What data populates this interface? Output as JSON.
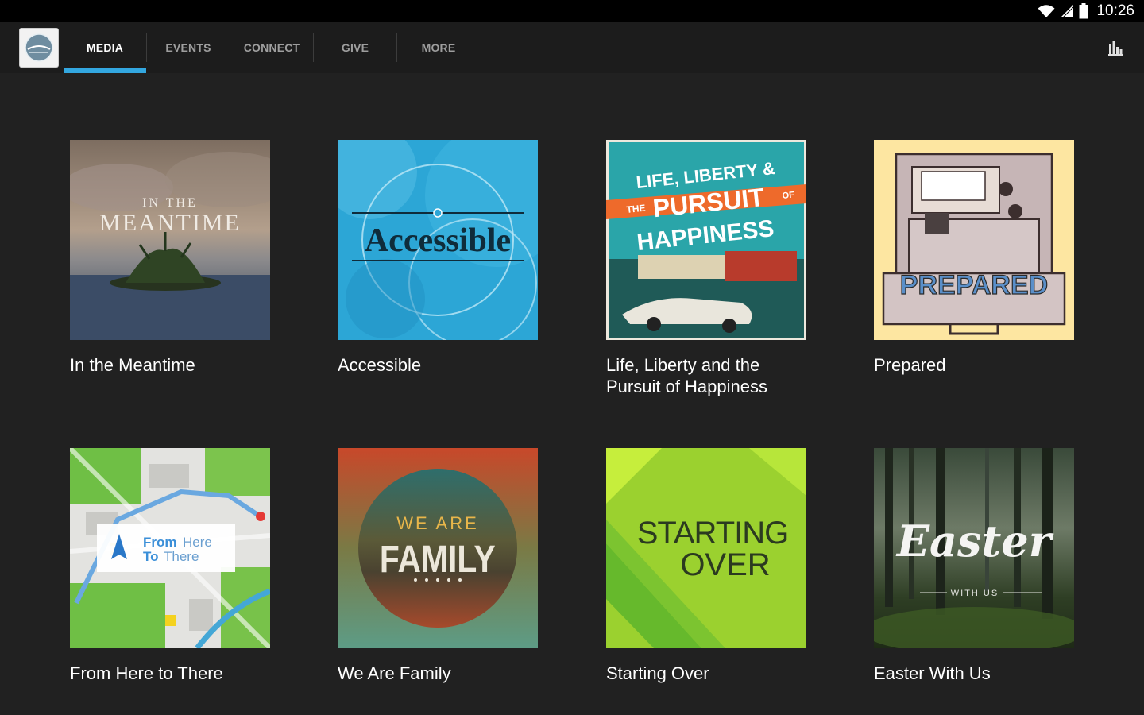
{
  "status_bar": {
    "time": "10:26",
    "icons": [
      "wifi-icon",
      "cell-signal-icon",
      "battery-icon"
    ]
  },
  "app": {
    "logo_icon": "church-logo-icon"
  },
  "tabs": [
    {
      "label": "MEDIA",
      "active": true
    },
    {
      "label": "EVENTS",
      "active": false
    },
    {
      "label": "CONNECT",
      "active": false
    },
    {
      "label": "GIVE",
      "active": false
    },
    {
      "label": "MORE",
      "active": false
    }
  ],
  "toolbar": {
    "stats_icon": "bar-chart-icon"
  },
  "colors": {
    "accent": "#33a7e0",
    "background": "#212121",
    "appbar": "#1c1c1c"
  },
  "series": [
    {
      "title": "In the Meantime",
      "art": {
        "line1": "IN THE",
        "line2": "MEANTIME"
      }
    },
    {
      "title": "Accessible",
      "art": {
        "line1": "Accessible"
      }
    },
    {
      "title": "Life, Liberty and the Pursuit of Happiness",
      "art": {
        "line1": "LIFE, LIBERTY &",
        "line2": "THE",
        "line3": "PURSUIT",
        "line4": "OF",
        "line5": "HAPPINESS"
      }
    },
    {
      "title": "Prepared",
      "art": {
        "line1": "PREPARED"
      }
    },
    {
      "title": "From Here to There",
      "art": {
        "line1": "From",
        "line2": "Here",
        "line3": "To",
        "line4": "There"
      }
    },
    {
      "title": "We Are Family",
      "art": {
        "line1": "WE ARE",
        "line2": "FAMILY"
      }
    },
    {
      "title": "Starting Over",
      "art": {
        "line1": "STARTING",
        "line2": "OVER"
      }
    },
    {
      "title": "Easter With Us",
      "art": {
        "line1": "Easter",
        "line2": "WITH US"
      }
    }
  ]
}
